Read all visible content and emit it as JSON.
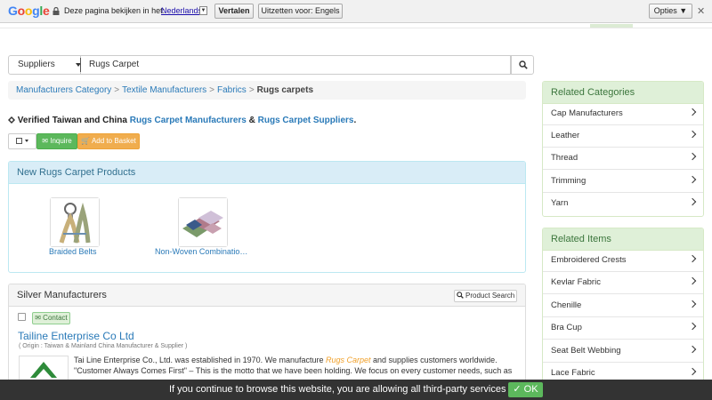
{
  "translate_bar": {
    "logo": [
      "G",
      "o",
      "o",
      "g",
      "l",
      "e"
    ],
    "question": "Deze pagina bekijken in het:",
    "language": "Nederlands",
    "translate_button": "Vertalen",
    "off_button": "Uitzetten voor: Engels",
    "options_button": "Opties ▼",
    "close": "✕"
  },
  "search": {
    "category": "Suppliers",
    "query": "Rugs Carpet"
  },
  "breadcrumb": {
    "items": [
      "Manufacturers Category",
      "Textile Manufacturers",
      "Fabrics"
    ],
    "separator": ">",
    "current": "Rugs carpets"
  },
  "verified": {
    "prefix": "Verified Taiwan and China ",
    "link1": "Rugs Carpet Manufacturers",
    "amp": " & ",
    "link2": "Rugs Carpet Suppliers",
    "suffix": "."
  },
  "actions": {
    "inquire": "✉ Inquire",
    "basket": "🛒 Add to Basket"
  },
  "new_products": {
    "title": "New Rugs Carpet Products",
    "items": [
      {
        "name": "Braided Belts"
      },
      {
        "name": "Non-Woven Combinatio…"
      }
    ]
  },
  "manufacturers": {
    "title": "Silver Manufacturers",
    "product_search": "Product Search",
    "contact_label": "✉ Contact",
    "company": "Tailine Enterprise Co Ltd",
    "origin": "( Origin : Taiwan & Mainland China Manufacturer & Supplier )",
    "desc_before": "Tai Line Enterprise Co., Ltd. was established in 1970. We manufacture ",
    "desc_em": "Rugs Carpet",
    "desc_after": " and supplies customers worldwide. \"Customer Always Comes First\" – This is the motto that we have been holding. We focus on every customer needs, such as"
  },
  "related_categories": {
    "title": "Related Categories",
    "items": [
      "Cap Manufacturers",
      "Leather",
      "Thread",
      "Trimming",
      "Yarn"
    ]
  },
  "related_items": {
    "title": "Related Items",
    "items": [
      "Embroidered Crests",
      "Kevlar Fabric",
      "Chenille",
      "Bra Cup",
      "Seat Belt Webbing",
      "Lace Fabric"
    ]
  },
  "cookie": {
    "text": "If you continue to browse this website, you are allowing all third-party services",
    "ok": "✓ OK"
  },
  "colors": {
    "link": "#2a7ab8",
    "success": "#5cb85c",
    "warning": "#f0ad4e",
    "info_panel": "#d9edf7",
    "success_panel": "#dff0d8"
  }
}
